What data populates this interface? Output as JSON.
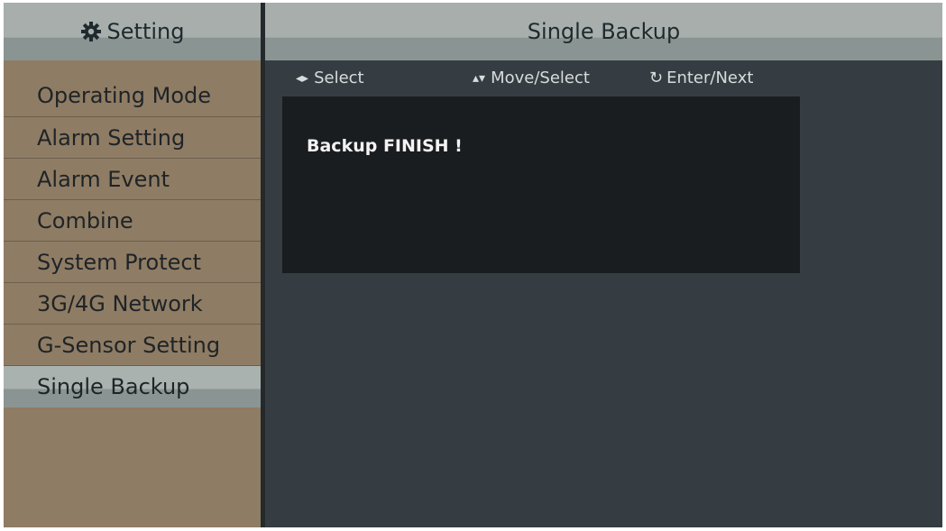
{
  "sidebar": {
    "header": {
      "title": "Setting",
      "icon": "gear-icon"
    },
    "items": [
      {
        "label": "Operating Mode",
        "active": false
      },
      {
        "label": "Alarm Setting",
        "active": false
      },
      {
        "label": "Alarm Event",
        "active": false
      },
      {
        "label": "Combine",
        "active": false
      },
      {
        "label": "System Protect",
        "active": false
      },
      {
        "label": "3G/4G Network",
        "active": false
      },
      {
        "label": "G-Sensor Setting",
        "active": false
      },
      {
        "label": "Single Backup",
        "active": true
      }
    ]
  },
  "main": {
    "title": "Single Backup",
    "hints": {
      "select": {
        "icon": "left-right-arrows-icon",
        "label": "Select"
      },
      "move": {
        "icon": "up-down-arrows-icon",
        "label": "Move/Select"
      },
      "enter": {
        "icon": "enter-icon",
        "label": "Enter/Next"
      }
    },
    "message": "Backup FINISH !"
  },
  "colors": {
    "sidebar_bg": "#8f7c64",
    "main_bg": "#353d42",
    "header_bg": "#a7aeab",
    "panel_bg": "#1a1d20"
  }
}
